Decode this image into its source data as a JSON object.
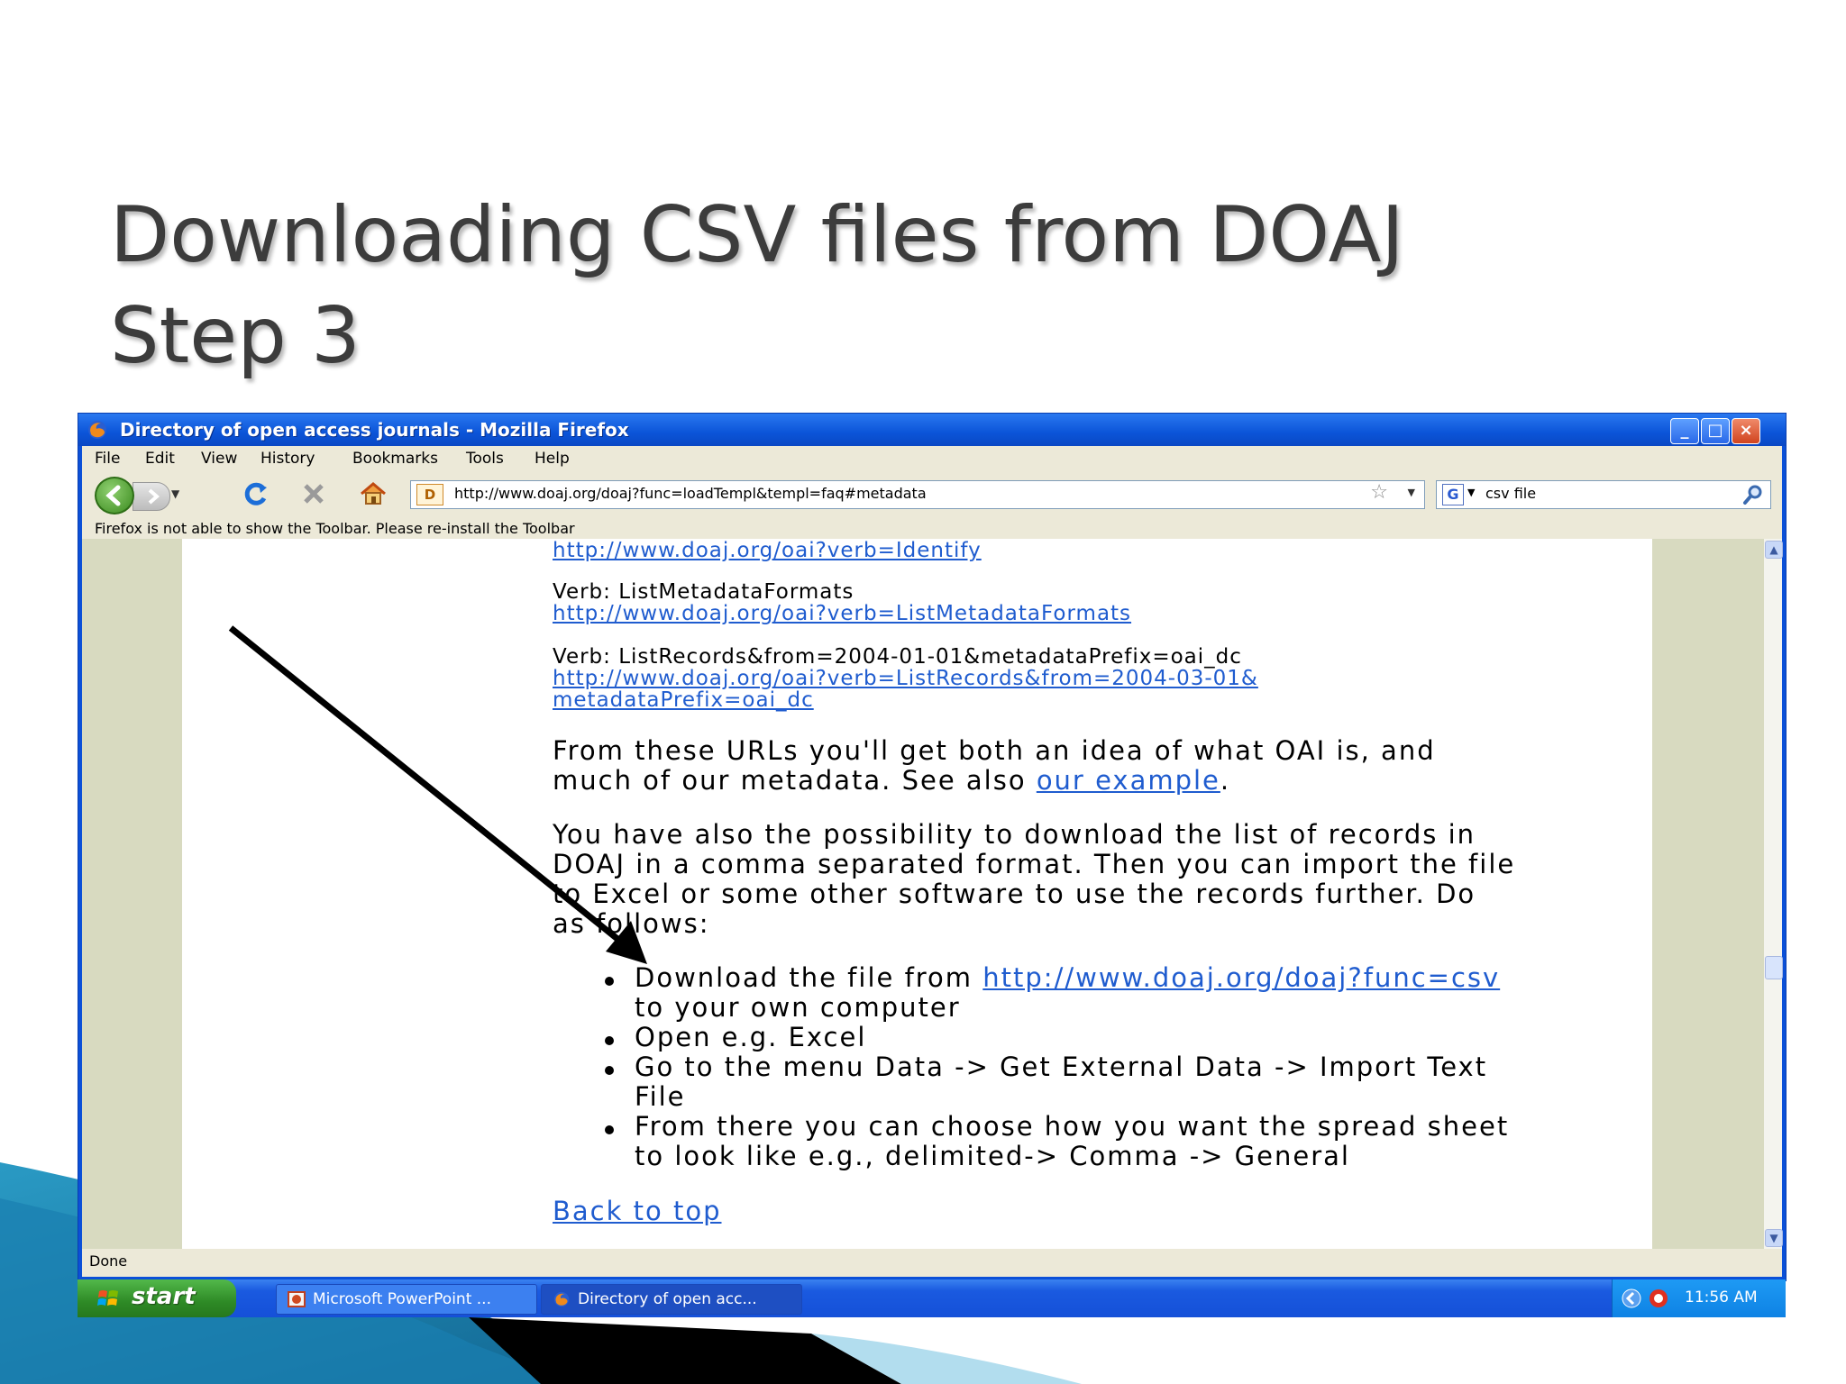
{
  "slide": {
    "title_line1": "Downloading  CSV files from DOAJ",
    "title_line2": "Step 3"
  },
  "window": {
    "title": "Directory of open access journals - Mozilla Firefox",
    "controls": {
      "minimize": "_",
      "maximize": "□",
      "close": "×"
    }
  },
  "menubar": {
    "items": [
      "File",
      "Edit",
      "View",
      "History",
      "Bookmarks",
      "Tools",
      "Help"
    ]
  },
  "navbar": {
    "url": "http://www.doaj.org/doaj?func=loadTempl&templ=faq#metadata",
    "site_icon_letter": "D",
    "search_engine_letter": "G",
    "search_value": "csv file"
  },
  "notice": "Firefox is not able to show the Toolbar. Please re-install the Toolbar",
  "content": {
    "link_identify": "http://www.doaj.org/oai?verb=Identify",
    "verb_listmetadata": "Verb: ListMetadataFormats",
    "link_listmetadata": "http://www.doaj.org/oai?verb=ListMetadataFormats",
    "verb_listrecords": "Verb: ListRecords&from=2004-01-01&metadataPrefix=oai_dc",
    "link_listrecords_1": "http://www.doaj.org/oai?verb=ListRecords&from=2004-03-01&",
    "link_listrecords_2": "metadataPrefix=oai_dc",
    "para1_line1": "From these URLs you'll get both an idea of what OAI is, and",
    "para1_line2_pre": "much of our metadata. See also ",
    "para1_link": "our example",
    "para1_end": ".",
    "para2_line1": "You have also the possibility to download the list of records in",
    "para2_line2": "DOAJ in a comma separated format. Then you can import the file",
    "para2_line3": "to Excel or some other software to use the records further. Do",
    "para2_line4": "as follows:",
    "b1_pre": "Download the file from ",
    "b1_link": "http://www.doaj.org/doaj?func=csv",
    "b1_line2": "to your own computer",
    "b2": "Open e.g. Excel",
    "b3_line1": "Go to the menu Data -> Get External Data -> Import Text",
    "b3_line2": "File",
    "b4_line1": "From there you can choose how you want the spread sheet",
    "b4_line2": "to look like e.g., delimited-> Comma -> General",
    "back_to_top": "Back to top"
  },
  "status": "Done",
  "taskbar": {
    "start_label": "start",
    "tasks": [
      {
        "label": "Microsoft PowerPoint ..."
      },
      {
        "label": "Directory of open acc..."
      }
    ],
    "clock": "11:56 AM"
  },
  "colors": {
    "link": "#1f5ccf",
    "xp_title_blue": "#0b54d8",
    "xp_start_green": "#2e8a26",
    "page_side": "#d8dac0",
    "slide_title": "#3c3c3c"
  },
  "icons": [
    "firefox-icon",
    "back-icon",
    "forward-icon",
    "reload-icon",
    "stop-icon",
    "home-icon",
    "bookmark-star-icon",
    "search-icon",
    "windows-flag-icon",
    "powerpoint-icon",
    "network-icon",
    "antivirus-icon",
    "annotation-arrow"
  ]
}
